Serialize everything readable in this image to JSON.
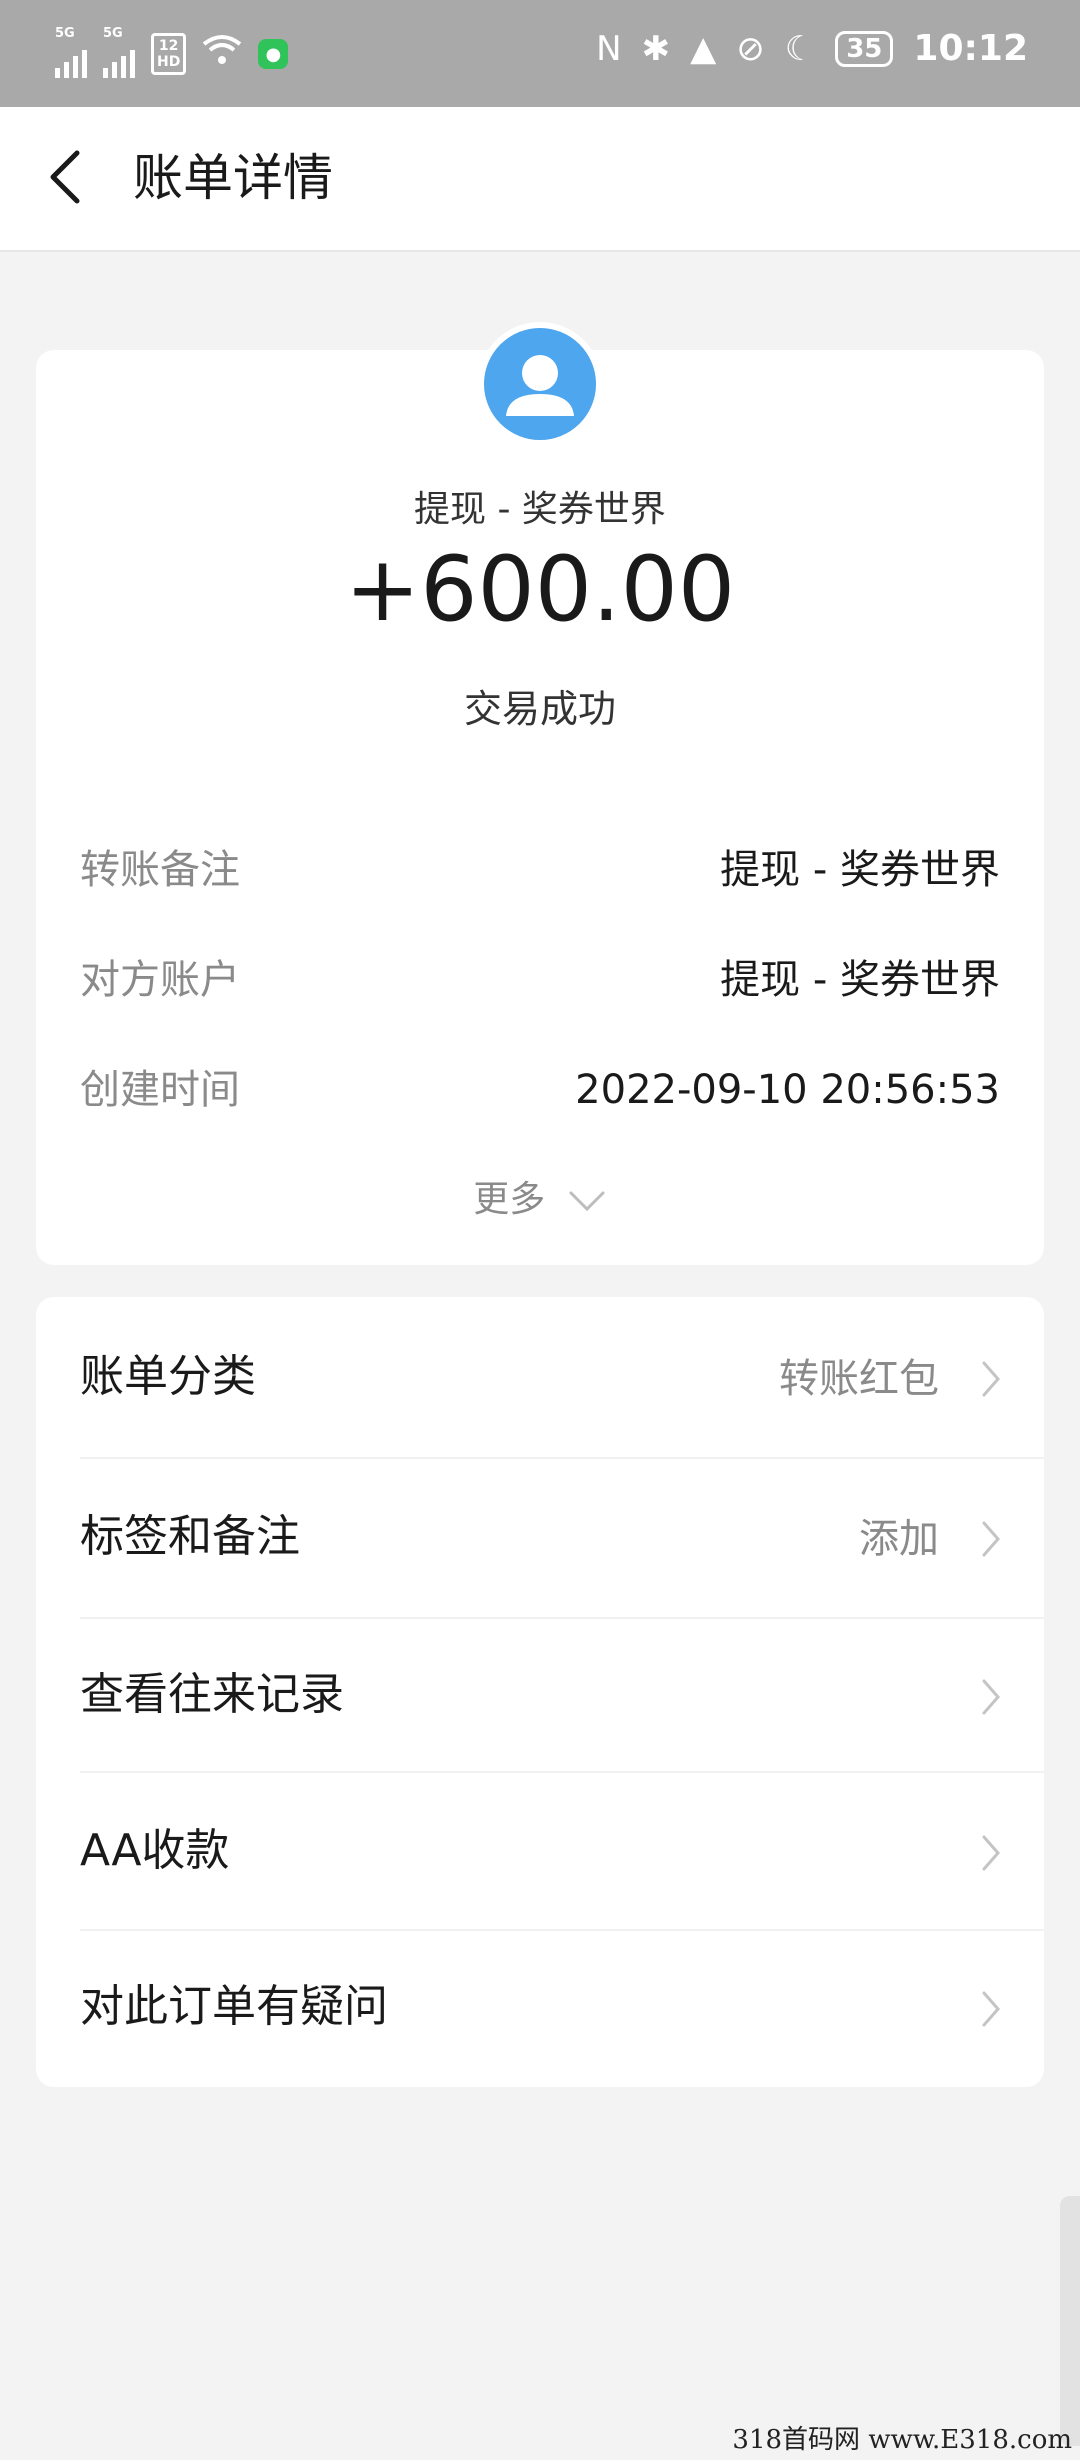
{
  "status_bar": {
    "signal1": "5G",
    "signal2": "5G",
    "hd_top": "12",
    "hd_bottom": "HD",
    "battery": "35",
    "time": "10:12"
  },
  "header": {
    "title": "账单详情"
  },
  "transaction": {
    "merchant": "提现 - 奖券世界",
    "amount": "+600.00",
    "status": "交易成功",
    "details": [
      {
        "key": "转账备注",
        "value": "提现 - 奖券世界"
      },
      {
        "key": "对方账户",
        "value": "提现 - 奖券世界"
      },
      {
        "key": "创建时间",
        "value": "2022-09-10 20:56:53"
      }
    ],
    "more_label": "更多"
  },
  "actions": [
    {
      "label": "账单分类",
      "value": "转账红包"
    },
    {
      "label": "标签和备注",
      "value": "添加"
    },
    {
      "label": "查看往来记录",
      "value": ""
    },
    {
      "label": "AA收款",
      "value": ""
    },
    {
      "label": "对此订单有疑问",
      "value": ""
    }
  ],
  "watermark": "318首码网 www.E318.com",
  "colors": {
    "avatar": "#4da6ee",
    "status_bar": "#a9a9a9",
    "background": "#f3f3f3"
  }
}
